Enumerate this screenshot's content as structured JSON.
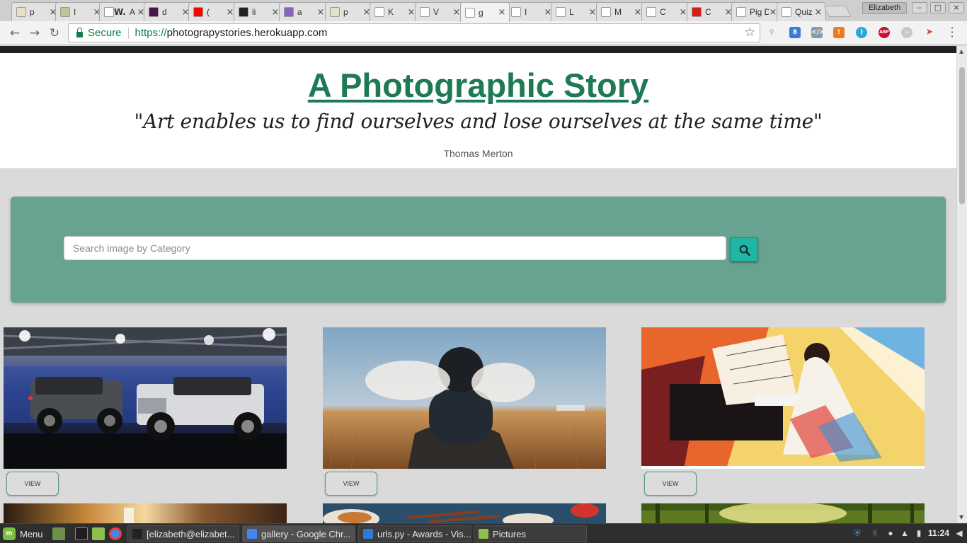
{
  "browser": {
    "tabs": [
      {
        "title": "p",
        "icon": "photo-icon",
        "color": "#e8e0c8"
      },
      {
        "title": "I",
        "icon": "tree-icon",
        "color": "#b9c79a"
      },
      {
        "title": "A",
        "icon": "w-icon",
        "color": "#ffffff",
        "prefix": "W."
      },
      {
        "title": "d",
        "icon": "slack-icon",
        "color": "#4a154b"
      },
      {
        "title": "(",
        "icon": "youtube-icon",
        "color": "#ff0000"
      },
      {
        "title": "li",
        "icon": "github-icon",
        "color": "#222222"
      },
      {
        "title": "a",
        "icon": "heroku-icon",
        "color": "#8a65c0"
      },
      {
        "title": "p",
        "icon": "photo-icon",
        "color": "#e8e0c8"
      },
      {
        "title": "K",
        "icon": "page-icon",
        "color": "#ffffff"
      },
      {
        "title": "V",
        "icon": "page-icon",
        "color": "#ffffff"
      },
      {
        "title": "g",
        "icon": "page-icon",
        "color": "#ffffff"
      },
      {
        "title": "I",
        "icon": "page-icon",
        "color": "#ffffff"
      },
      {
        "title": "L",
        "icon": "page-icon",
        "color": "#ffffff"
      },
      {
        "title": "M",
        "icon": "page-icon",
        "color": "#ffffff"
      },
      {
        "title": "C",
        "icon": "page-icon",
        "color": "#ffffff"
      },
      {
        "title": "C",
        "icon": "angular-icon",
        "color": "#dd1b16"
      },
      {
        "title": "Pig D",
        "icon": "page-icon",
        "color": "#ffffff"
      },
      {
        "title": "Quiz",
        "icon": "page-icon",
        "color": "#ffffff"
      }
    ],
    "active_tab_index": 10,
    "profile_name": "Elizabeth",
    "omnibox": {
      "secure_label": "Secure",
      "scheme": "https://",
      "host": "photograpystories.herokuapp.com"
    }
  },
  "page": {
    "site_title": "A Photographic Story",
    "quote": "\"Art enables us to find ourselves and lose ourselves at the same time\"",
    "quote_author": "Thomas Merton",
    "search": {
      "placeholder": "Search image by Category",
      "button_icon": "search-icon"
    },
    "cards": [
      {
        "image": "jeeps-in-garage",
        "button": "VIEW"
      },
      {
        "image": "person-sitting-in-field",
        "button": "VIEW"
      },
      {
        "image": "painting-woman-at-piano",
        "button": "VIEW"
      },
      {
        "image": "coffee-cup",
        "button": ""
      },
      {
        "image": "food-platter",
        "button": ""
      },
      {
        "image": "forest-path",
        "button": ""
      }
    ]
  },
  "taskbar": {
    "menu_label": "Menu",
    "windows": [
      {
        "title": "[elizabeth@elizabet...",
        "icon": "terminal-icon",
        "color": "#222222"
      },
      {
        "title": "gallery - Google Chr...",
        "icon": "chrome-icon",
        "color": "#4285f4",
        "active": true
      },
      {
        "title": "urls.py - Awards - Vis...",
        "icon": "vscode-icon",
        "color": "#2f7bd4"
      },
      {
        "title": "Pictures",
        "icon": "folder-icon",
        "color": "#8fbf4f"
      }
    ],
    "clock": "11:24"
  }
}
